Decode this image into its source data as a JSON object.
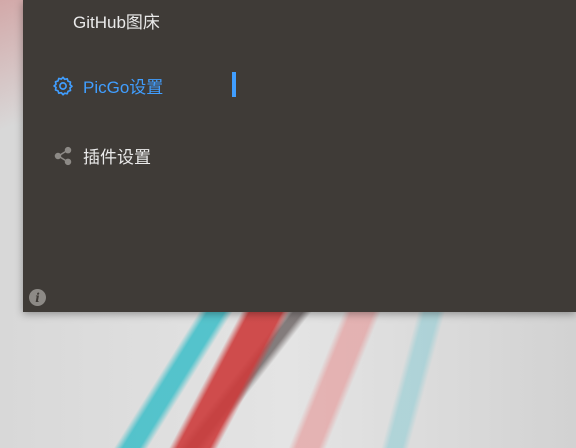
{
  "sidebar": {
    "items": [
      {
        "label": "GitHub图床",
        "icon": "none",
        "active": false
      },
      {
        "label": "PicGo设置",
        "icon": "gear-icon",
        "active": true
      },
      {
        "label": "插件设置",
        "icon": "share-icon",
        "active": false
      }
    ],
    "info_icon": "info-icon"
  },
  "colors": {
    "accent": "#409eff",
    "panel": "#3f3b37",
    "text": "#eaeaea",
    "info": "#8d8a86"
  }
}
